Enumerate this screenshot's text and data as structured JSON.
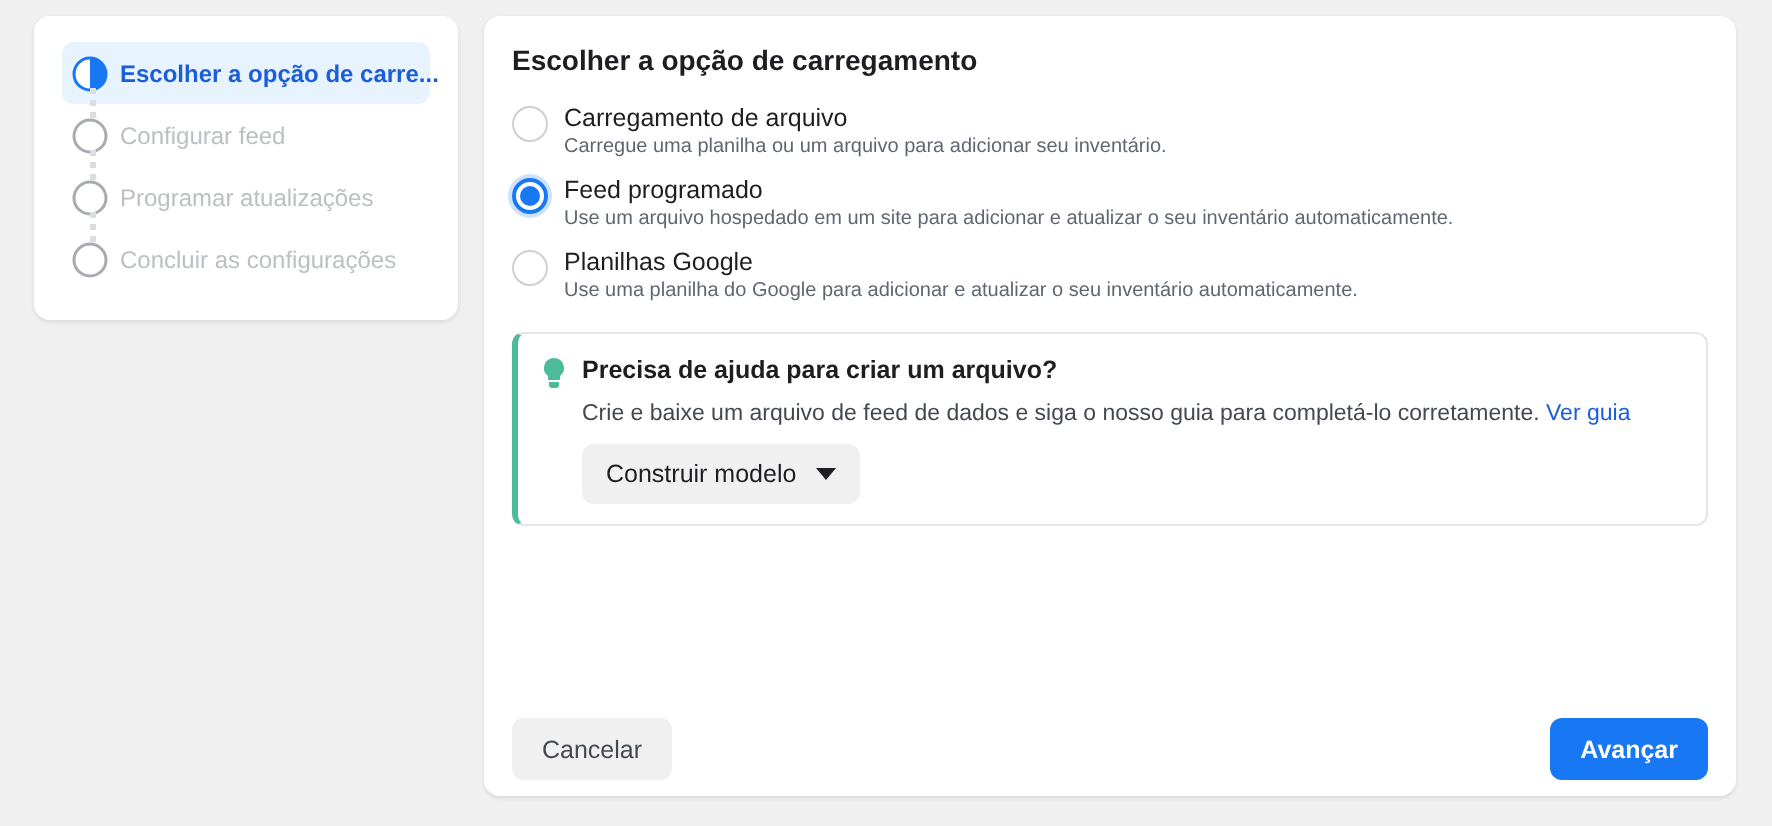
{
  "steps": [
    {
      "label": "Escolher a opção de carre...",
      "selected": true
    },
    {
      "label": "Configurar feed",
      "selected": false
    },
    {
      "label": "Programar atualizações",
      "selected": false
    },
    {
      "label": "Concluir as configurações",
      "selected": false
    }
  ],
  "panel": {
    "title": "Escolher a opção de carregamento",
    "options": [
      {
        "label": "Carregamento de arquivo",
        "description": "Carregue uma planilha ou um arquivo para adicionar seu inventário.",
        "selected": false
      },
      {
        "label": "Feed programado",
        "description": "Use um arquivo hospedado em um site para adicionar e atualizar o seu inventário automaticamente.",
        "selected": true
      },
      {
        "label": "Planilhas Google",
        "description": "Use uma planilha do Google para adicionar e atualizar o seu inventário automaticamente.",
        "selected": false
      }
    ],
    "help": {
      "title": "Precisa de ajuda para criar um arquivo?",
      "text": "Crie e baixe um arquivo de feed de dados e siga o nosso guia para completá-lo corretamente.",
      "link": "Ver guia",
      "button": "Construir modelo"
    },
    "buttons": {
      "cancel": "Cancelar",
      "next": "Avançar"
    }
  }
}
